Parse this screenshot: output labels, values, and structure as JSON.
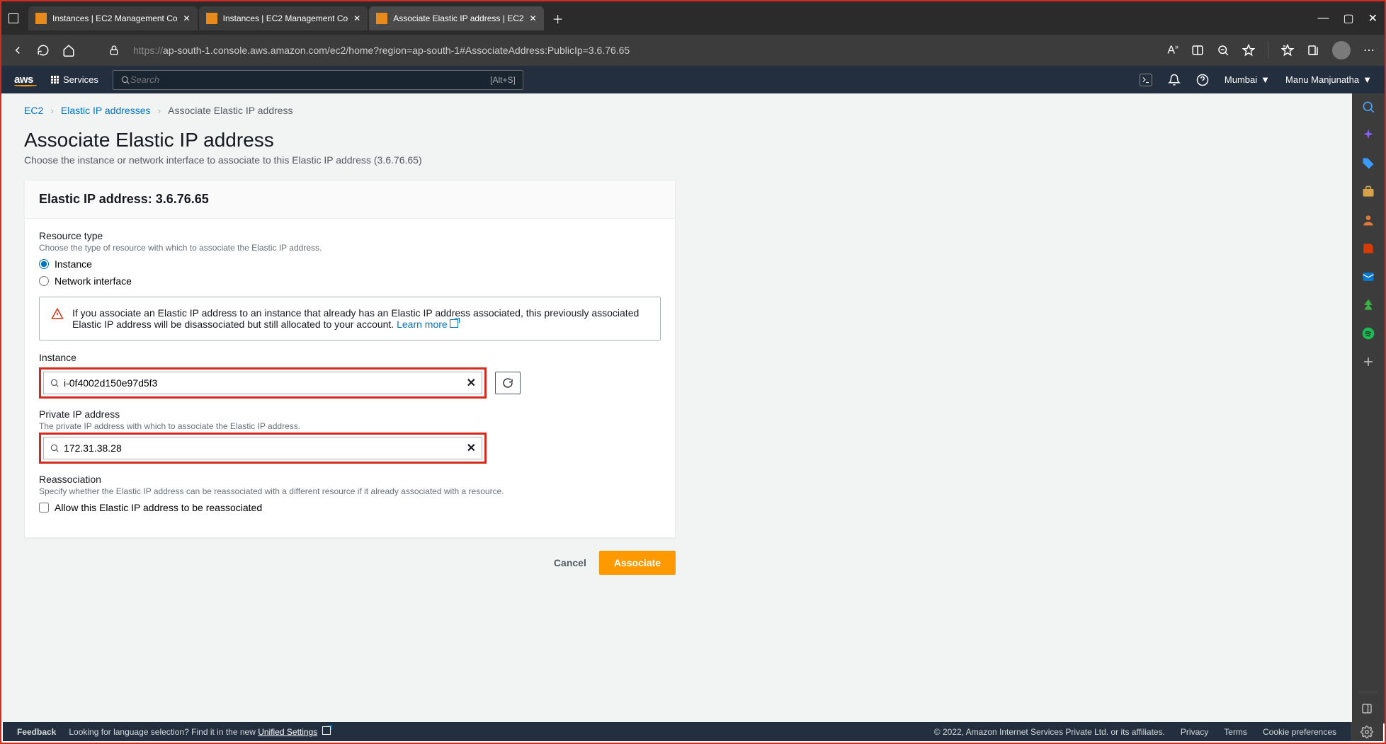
{
  "browser": {
    "tabs": [
      {
        "title": "Instances | EC2 Management Co",
        "active": false
      },
      {
        "title": "Instances | EC2 Management Co",
        "active": false
      },
      {
        "title": "Associate Elastic IP address | EC2",
        "active": true
      }
    ],
    "url_https": "https://",
    "url_rest": "ap-south-1.console.aws.amazon.com/ec2/home?region=ap-south-1#AssociateAddress:PublicIp=3.6.76.65"
  },
  "aws_header": {
    "services_label": "Services",
    "search_placeholder": "Search",
    "search_hint": "[Alt+S]",
    "region": "Mumbai",
    "user": "Manu Manjunatha"
  },
  "breadcrumb": {
    "ec2": "EC2",
    "eip": "Elastic IP addresses",
    "current": "Associate Elastic IP address"
  },
  "page": {
    "title": "Associate Elastic IP address",
    "description": "Choose the instance or network interface to associate to this Elastic IP address (3.6.76.65)"
  },
  "panel": {
    "header": "Elastic IP address: 3.6.76.65",
    "resource_type": {
      "label": "Resource type",
      "help": "Choose the type of resource with which to associate the Elastic IP address.",
      "option_instance": "Instance",
      "option_eni": "Network interface"
    },
    "alert": {
      "text": "If you associate an Elastic IP address to an instance that already has an Elastic IP address associated, this previously associated Elastic IP address will be disassociated but still allocated to your account.",
      "learn_more": "Learn more"
    },
    "instance": {
      "label": "Instance",
      "value": "i-0f4002d150e97d5f3"
    },
    "private_ip": {
      "label": "Private IP address",
      "help": "The private IP address with which to associate the Elastic IP address.",
      "value": "172.31.38.28"
    },
    "reassociation": {
      "label": "Reassociation",
      "help": "Specify whether the Elastic IP address can be reassociated with a different resource if it already associated with a resource.",
      "checkbox_label": "Allow this Elastic IP address to be reassociated"
    }
  },
  "actions": {
    "cancel": "Cancel",
    "associate": "Associate"
  },
  "footer": {
    "feedback": "Feedback",
    "lang_text_a": "Looking for language selection? Find it in the new ",
    "lang_text_b": "Unified Settings",
    "copyright": "© 2022, Amazon Internet Services Private Ltd. or its affiliates.",
    "privacy": "Privacy",
    "terms": "Terms",
    "cookie": "Cookie preferences"
  }
}
